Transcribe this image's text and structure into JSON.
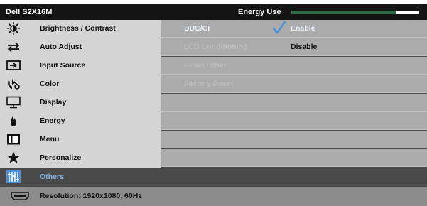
{
  "header": {
    "model": "Dell S2X16M",
    "energy_label": "Energy Use",
    "energy_level_percent": 82
  },
  "menu": {
    "items": [
      {
        "label": "Brightness / Contrast",
        "icon": "brightness-icon"
      },
      {
        "label": "Auto Adjust",
        "icon": "auto-adjust-icon"
      },
      {
        "label": "Input Source",
        "icon": "input-source-icon"
      },
      {
        "label": "Color",
        "icon": "color-icon"
      },
      {
        "label": "Display",
        "icon": "display-icon"
      },
      {
        "label": "Energy",
        "icon": "energy-icon"
      },
      {
        "label": "Menu",
        "icon": "menu-icon"
      },
      {
        "label": "Personalize",
        "icon": "star-icon"
      },
      {
        "label": "Others",
        "icon": "others-icon"
      }
    ],
    "active_index": 8
  },
  "panel": {
    "rows": [
      {
        "option": "DDC/CI",
        "value": "Enable",
        "enabled": true,
        "selected": true
      },
      {
        "option": "LCD Conditioning",
        "value": "Disable",
        "enabled": false,
        "selected": false
      },
      {
        "option": "Reset Other",
        "value": "",
        "enabled": false,
        "selected": false
      },
      {
        "option": "Factory Reset",
        "value": "",
        "enabled": false,
        "selected": false
      }
    ]
  },
  "footer": {
    "resolution": "Resolution: 1920x1080, 60Hz",
    "icon": "hdmi-icon"
  },
  "colors": {
    "menu_bg": "#d4d4d4",
    "active_bg": "#4a4a4a",
    "panel_row_bg": "#ababab",
    "energy_fill": "#2e6b46",
    "check_blue": "#4a90d9"
  }
}
